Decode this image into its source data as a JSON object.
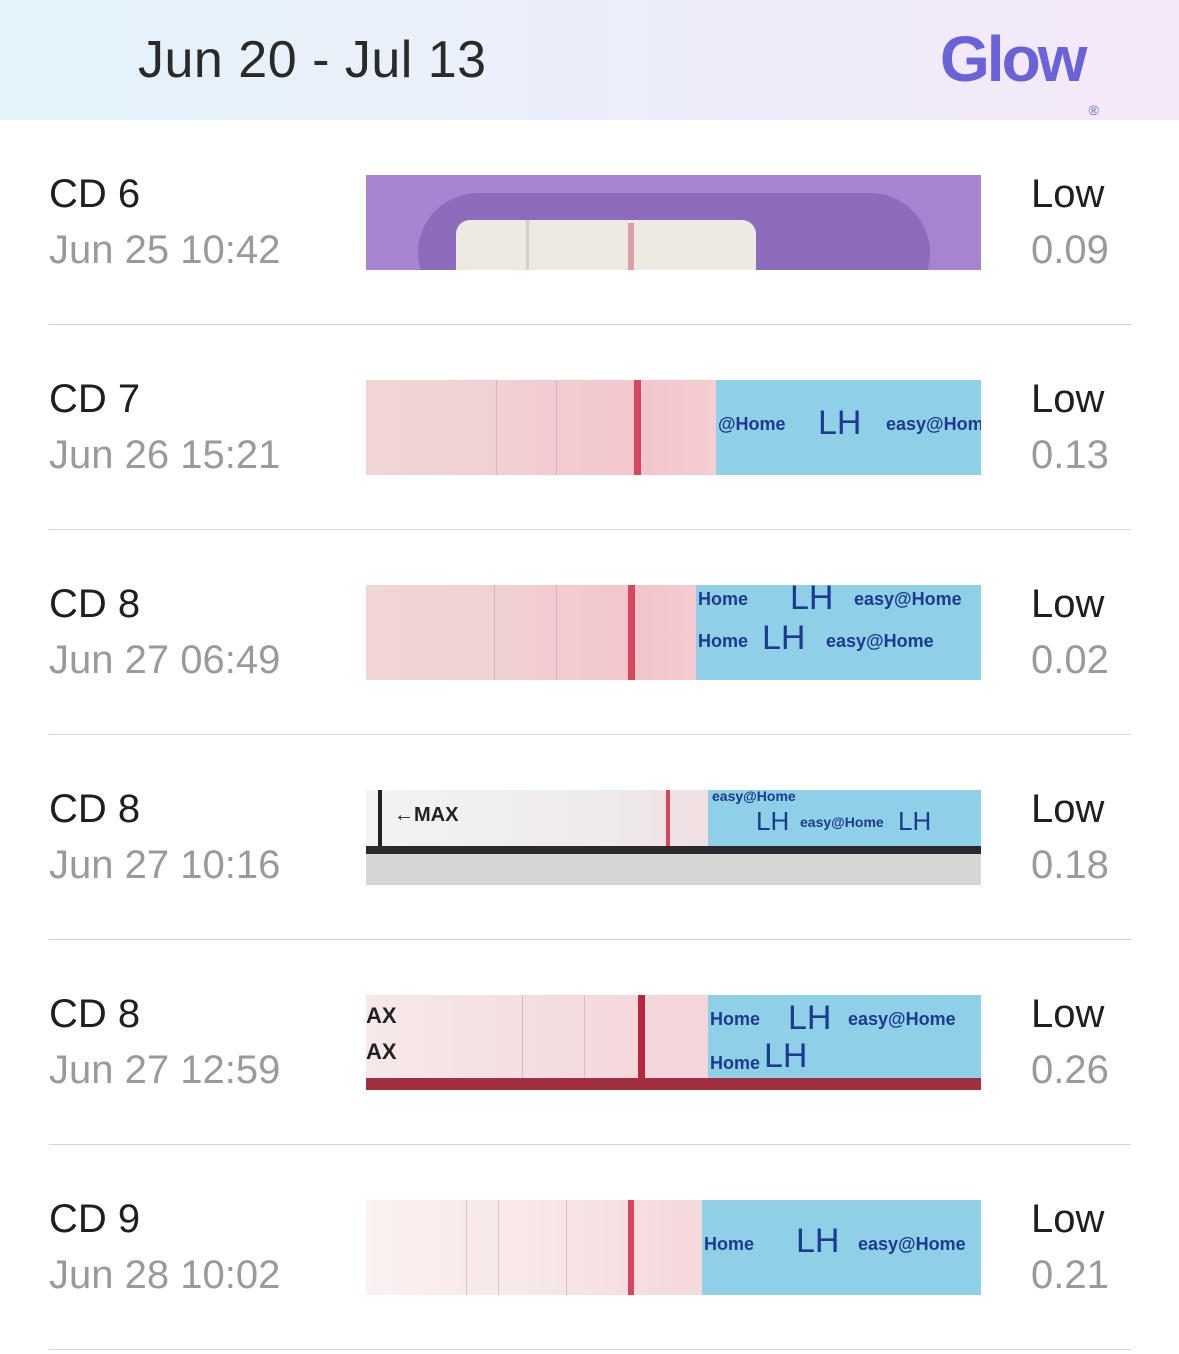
{
  "header": {
    "date_range": "Jun 20 - Jul 13",
    "logo_text": "Glow",
    "logo_mark": "®",
    "logo_color": "#6a62d9"
  },
  "entries": [
    {
      "cycle_day": "CD 6",
      "datetime": "Jun 25 10:42",
      "status": "Low",
      "value": "0.09"
    },
    {
      "cycle_day": "CD 7",
      "datetime": "Jun 26 15:21",
      "status": "Low",
      "value": "0.13"
    },
    {
      "cycle_day": "CD 8",
      "datetime": "Jun 27 06:49",
      "status": "Low",
      "value": "0.02"
    },
    {
      "cycle_day": "CD 8",
      "datetime": "Jun 27 10:16",
      "status": "Low",
      "value": "0.18"
    },
    {
      "cycle_day": "CD 8",
      "datetime": "Jun 27 12:59",
      "status": "Low",
      "value": "0.26"
    },
    {
      "cycle_day": "CD 9",
      "datetime": "Jun 28 10:02",
      "status": "Low",
      "value": "0.21"
    }
  ],
  "strip_text": {
    "brand": "easy@Home",
    "test": "LH",
    "max": "MAX",
    "max_arrow": "←MAX",
    "partial_max": "AX",
    "partial_brand_a": "@Home",
    "partial_brand_b": "Home",
    "partial_brand_c": "Ho"
  }
}
